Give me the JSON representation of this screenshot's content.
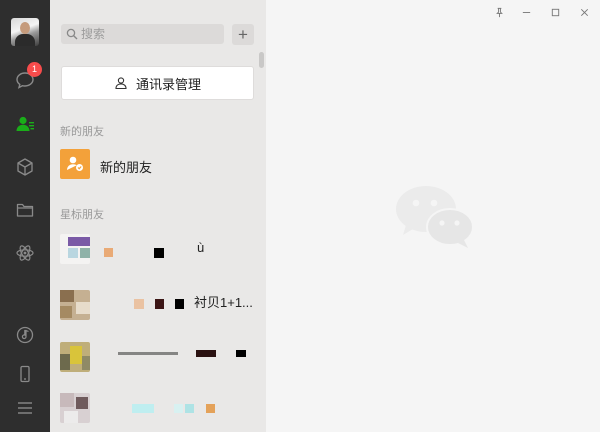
{
  "nav": {
    "badge_count": "1",
    "items": [
      "chat-icon",
      "contacts-icon",
      "cube-icon",
      "folder-icon",
      "atom-icon",
      "music-icon",
      "phone-icon",
      "menu-icon"
    ]
  },
  "search": {
    "placeholder": "搜索"
  },
  "contacts": {
    "manage_label": "通讯录管理",
    "new_friends_header": "新的朋友",
    "new_friends_item": "新的朋友",
    "starred_header": "星标朋友",
    "starred": [
      {
        "name": "ù"
      },
      {
        "name": "衬贝1+1..."
      },
      {
        "name": ""
      },
      {
        "name": ""
      }
    ]
  },
  "colors": {
    "accent": "#1aad19",
    "nav_bg": "#2e2e2e",
    "badge": "#f74c4c",
    "new_friend_avatar": "#f3a13a"
  }
}
